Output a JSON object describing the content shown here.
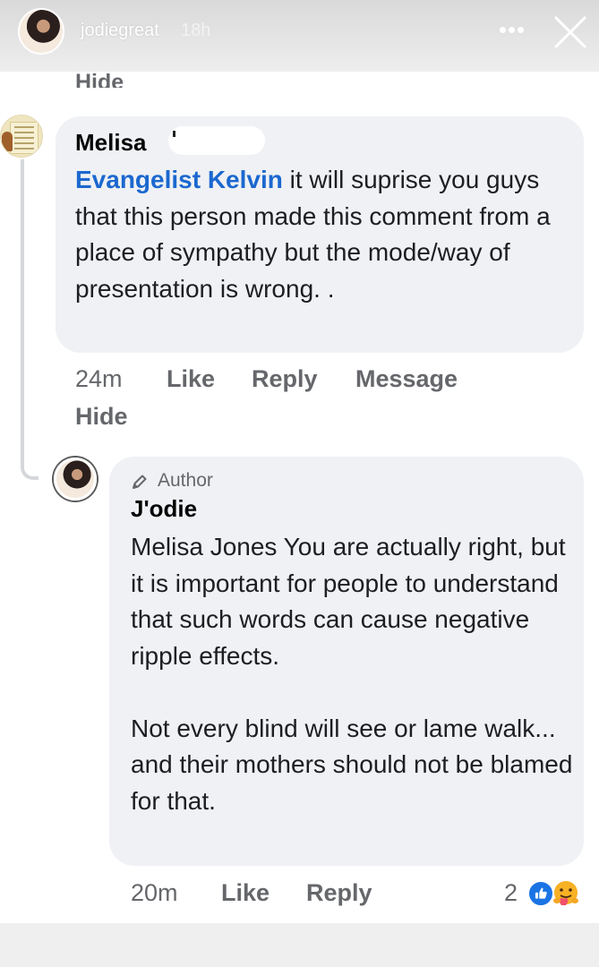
{
  "story": {
    "username": "jodiegreat",
    "time": "18h",
    "more_label": "•••"
  },
  "top": {
    "hide_label": "Hide"
  },
  "comment1": {
    "author": "Melisa",
    "mention": "Evangelist Kelvin",
    "text": " it will suprise you guys that this person made this comment from a place of sympathy but the mode/way of presentation is wrong. .",
    "time": "24m",
    "like_label": "Like",
    "reply_label": "Reply",
    "message_label": "Message",
    "hide_label": "Hide"
  },
  "comment2": {
    "badge": "Author",
    "author": "J'odie",
    "paragraph1": "Melisa Jones You are actually right, but it is important for people to understand that such words can cause negative ripple effects.",
    "paragraph2": "Not every blind will see or lame walk... and their mothers should not be blamed for that.",
    "time": "20m",
    "like_label": "Like",
    "reply_label": "Reply",
    "reaction_count": "2",
    "reactions": [
      "like-icon",
      "care-icon"
    ]
  },
  "colors": {
    "mention": "#1b68cf",
    "bubble": "#eff1f4",
    "meta": "#65676b",
    "like_reaction": "#1b74e4"
  }
}
